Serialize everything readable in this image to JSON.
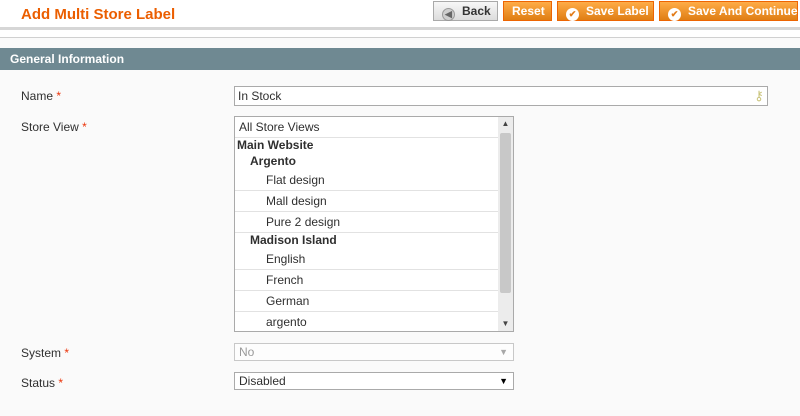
{
  "header": {
    "title": "Add Multi Store Label",
    "buttons": {
      "back": "Back",
      "reset": "Reset",
      "save": "Save Label",
      "save_continue": "Save And Continue"
    }
  },
  "section": {
    "title": "General Information"
  },
  "form": {
    "name": {
      "label": "Name",
      "required_mark": "*",
      "value": "In Stock"
    },
    "store_view": {
      "label": "Store View",
      "required_mark": "*",
      "options": [
        {
          "label": "All Store Views"
        },
        {
          "label": "Main Website"
        },
        {
          "label": "Argento"
        },
        {
          "label": "Flat design"
        },
        {
          "label": "Mall design"
        },
        {
          "label": "Pure 2 design"
        },
        {
          "label": "Madison Island"
        },
        {
          "label": "English"
        },
        {
          "label": "French"
        },
        {
          "label": "German"
        },
        {
          "label": "argento"
        }
      ]
    },
    "system": {
      "label": "System",
      "required_mark": "*",
      "value": "No",
      "disabled": true
    },
    "status": {
      "label": "Status",
      "required_mark": "*",
      "value": "Disabled"
    }
  },
  "colors": {
    "accent": "#eb5e00",
    "button_orange": "#f18200",
    "section_header": "#6f8992",
    "required": "#eb340a"
  },
  "icons": {
    "back": "back-arrow-icon",
    "save": "check-circle-icon",
    "input_helper": "key-icon"
  }
}
